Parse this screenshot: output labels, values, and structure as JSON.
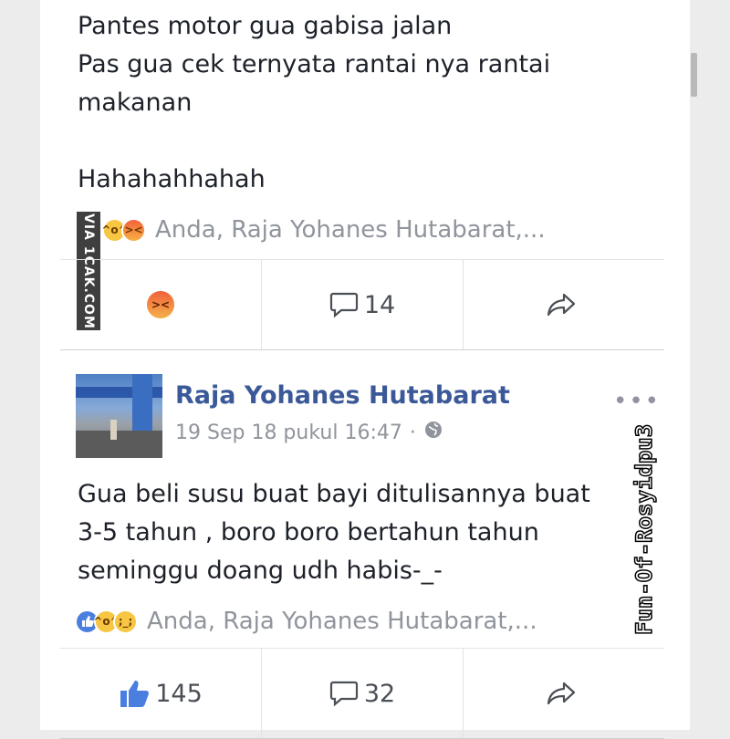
{
  "post1": {
    "text": "Pantes motor gua gabisa jalan\nPas gua cek ternyata rantai nya rantai\nmakanan\n\nHahahahhahah",
    "reactions": [
      "haha",
      "angry"
    ],
    "reaction_names": "Anda, Raja Yohanes Hutabarat,...",
    "actions": {
      "react_icon": "angry-icon",
      "comment_icon": "comment-icon",
      "comment_count": "14",
      "share_icon": "share-icon"
    }
  },
  "post2": {
    "author": "Raja Yohanes Hutabarat",
    "timestamp": "19 Sep 18 pukul 16:47",
    "separator": "·",
    "privacy_icon": "globe-icon",
    "more": "•••",
    "text": "Gua beli susu buat bayi  ditulisannya buat\n3-5 tahun , boro boro bertahun tahun\nseminggu doang udh habis-_-",
    "reactions": [
      "like",
      "haha",
      "sad"
    ],
    "reaction_names": "Anda, Raja Yohanes Hutabarat,...",
    "actions": {
      "like_icon": "thumbs-up-icon",
      "like_count": "145",
      "comment_icon": "comment-icon",
      "comment_count": "32",
      "share_icon": "share-icon"
    }
  },
  "watermarks": {
    "left": "VIA 1CAK.COM",
    "right": "Fun-Of-Rosyidpu3"
  },
  "colors": {
    "link": "#3b5998",
    "text": "#1d2129",
    "muted": "#90949c",
    "like": "#4a7fe0"
  }
}
